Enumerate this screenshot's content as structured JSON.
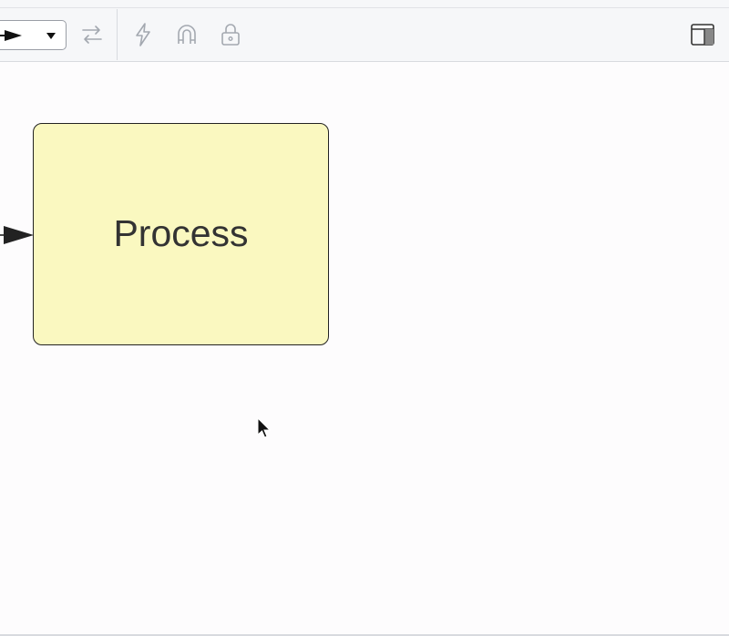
{
  "toolbar": {
    "arrow_style_select": {
      "value_icon": "arrow-right-filled",
      "caret_icon": "caret-down-icon"
    },
    "icons": [
      "swap-direction-icon",
      "lightning-icon",
      "magnet-icon",
      "lock-icon",
      "panel-toggle-icon"
    ]
  },
  "canvas": {
    "node": {
      "label": "Process",
      "fill": "#faf8c0",
      "stroke": "#222222"
    },
    "edge": {
      "style": "solid",
      "head": "filled-triangle"
    }
  },
  "colors": {
    "toolbar_bg": "#f6f7f9",
    "canvas_bg": "#fdfcfd",
    "icon_gray": "#9aa0a8"
  }
}
